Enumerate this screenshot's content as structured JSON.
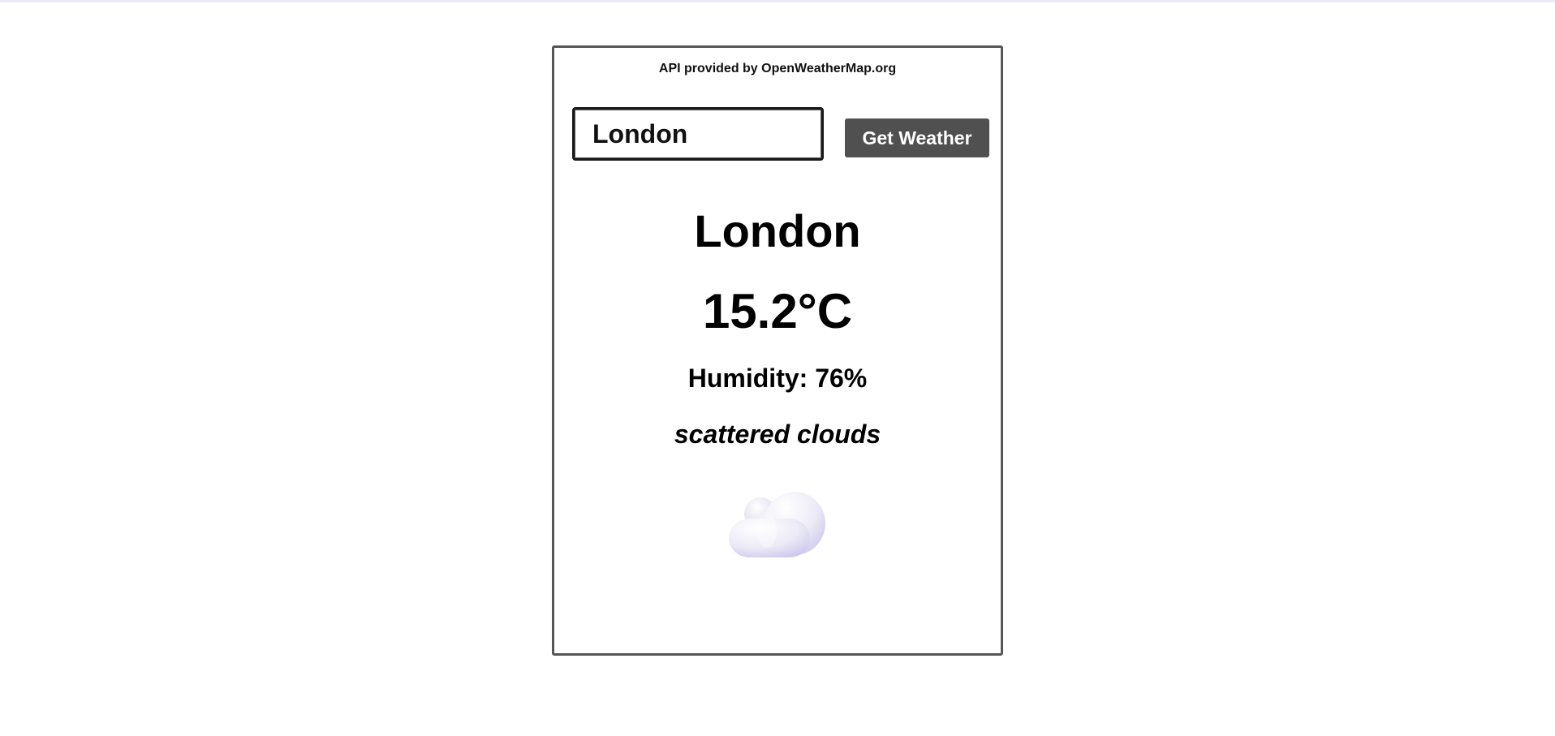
{
  "attribution": "API provided by OpenWeatherMap.org",
  "search": {
    "value": "London",
    "button_label": "Get Weather"
  },
  "weather": {
    "city": "London",
    "temperature": "15.2°C",
    "humidity": "Humidity: 76%",
    "description": "scattered clouds",
    "icon": "scattered-clouds-icon"
  },
  "colors": {
    "button_bg": "#505050",
    "card_border": "#555555",
    "cloud_light": "#f4f3fa",
    "cloud_shadow": "#c9c4ec"
  }
}
